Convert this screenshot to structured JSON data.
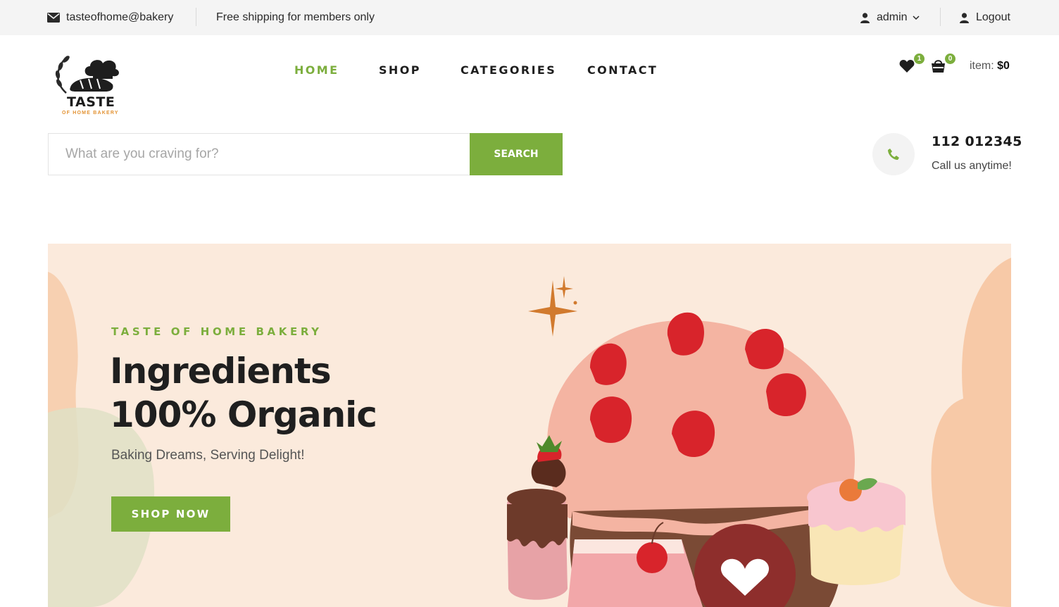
{
  "topbar": {
    "email": "tasteofhome@bakery",
    "shipping_note": "Free shipping for members only",
    "user": "admin",
    "logout": "Logout"
  },
  "brand": {
    "logo_title": "TASTE",
    "logo_subtitle": "OF HOME BAKERY"
  },
  "nav": {
    "items": [
      {
        "label": "HOME",
        "active": true
      },
      {
        "label": "SHOP",
        "active": false
      },
      {
        "label": "CATEGORIES",
        "active": false
      },
      {
        "label": "CONTACT",
        "active": false
      }
    ]
  },
  "header_icons": {
    "wishlist_count": "1",
    "cart_count": "0",
    "cart_label": "item:",
    "cart_total": "$0"
  },
  "search": {
    "placeholder": "What are you craving for?",
    "value": "",
    "button": "SEARCH"
  },
  "contact": {
    "phone": "112 012345",
    "note": "Call us anytime!"
  },
  "hero": {
    "tagline": "TASTE OF HOME BAKERY",
    "headline_line1": "Ingredients",
    "headline_line2": "100% Organic",
    "subtitle": "Baking Dreams, Serving Delight!",
    "cta": "SHOP NOW"
  },
  "colors": {
    "accent": "#7cae3d",
    "topbar_bg": "#f4f4f4",
    "hero_bg": "#fbeadc",
    "text_dark": "#1f1f1f"
  },
  "icons": [
    "envelope-icon",
    "user-icon",
    "chevron-down-icon",
    "logout-user-icon",
    "heart-icon",
    "shopping-bag-icon",
    "phone-icon"
  ]
}
